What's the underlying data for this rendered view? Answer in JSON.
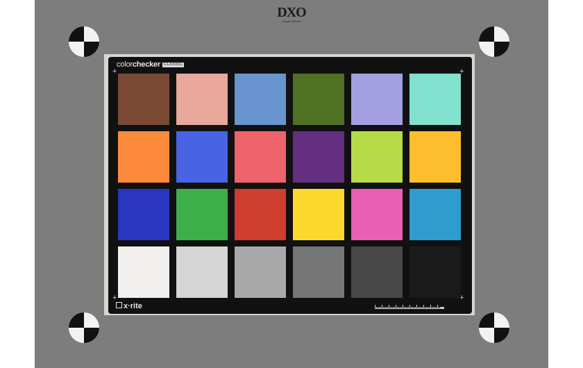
{
  "logo": {
    "main": "DXO",
    "sub": "Image Science"
  },
  "card": {
    "brand_light": "color",
    "brand_bold": "checker",
    "brand_sub": "CLASSIC",
    "maker": "x·rite"
  },
  "patches": [
    {
      "name": "dark-skin",
      "color": "#7a4a34"
    },
    {
      "name": "light-skin",
      "color": "#e8a89c"
    },
    {
      "name": "blue-sky",
      "color": "#6895cf"
    },
    {
      "name": "foliage",
      "color": "#4f7124"
    },
    {
      "name": "blue-flower",
      "color": "#a39fe0"
    },
    {
      "name": "bluish-green",
      "color": "#82e0cf"
    },
    {
      "name": "orange",
      "color": "#fb8a3a"
    },
    {
      "name": "purplish-blue",
      "color": "#4863e4"
    },
    {
      "name": "moderate-red",
      "color": "#ef636d"
    },
    {
      "name": "purple",
      "color": "#642f80"
    },
    {
      "name": "yellow-green",
      "color": "#b6db47"
    },
    {
      "name": "orange-yellow",
      "color": "#fdbf2e"
    },
    {
      "name": "blue",
      "color": "#2a36bf"
    },
    {
      "name": "green",
      "color": "#3eae48"
    },
    {
      "name": "red",
      "color": "#cf3c30"
    },
    {
      "name": "yellow",
      "color": "#fbd82d"
    },
    {
      "name": "magenta",
      "color": "#e85fb4"
    },
    {
      "name": "cyan",
      "color": "#2f9cd0"
    },
    {
      "name": "white",
      "color": "#f1f0ee"
    },
    {
      "name": "neutral-8",
      "color": "#d5d5d6"
    },
    {
      "name": "neutral-6-5",
      "color": "#a9a9aa"
    },
    {
      "name": "neutral-5",
      "color": "#767676"
    },
    {
      "name": "neutral-3-5",
      "color": "#484848"
    },
    {
      "name": "black",
      "color": "#1a1a1a"
    }
  ]
}
